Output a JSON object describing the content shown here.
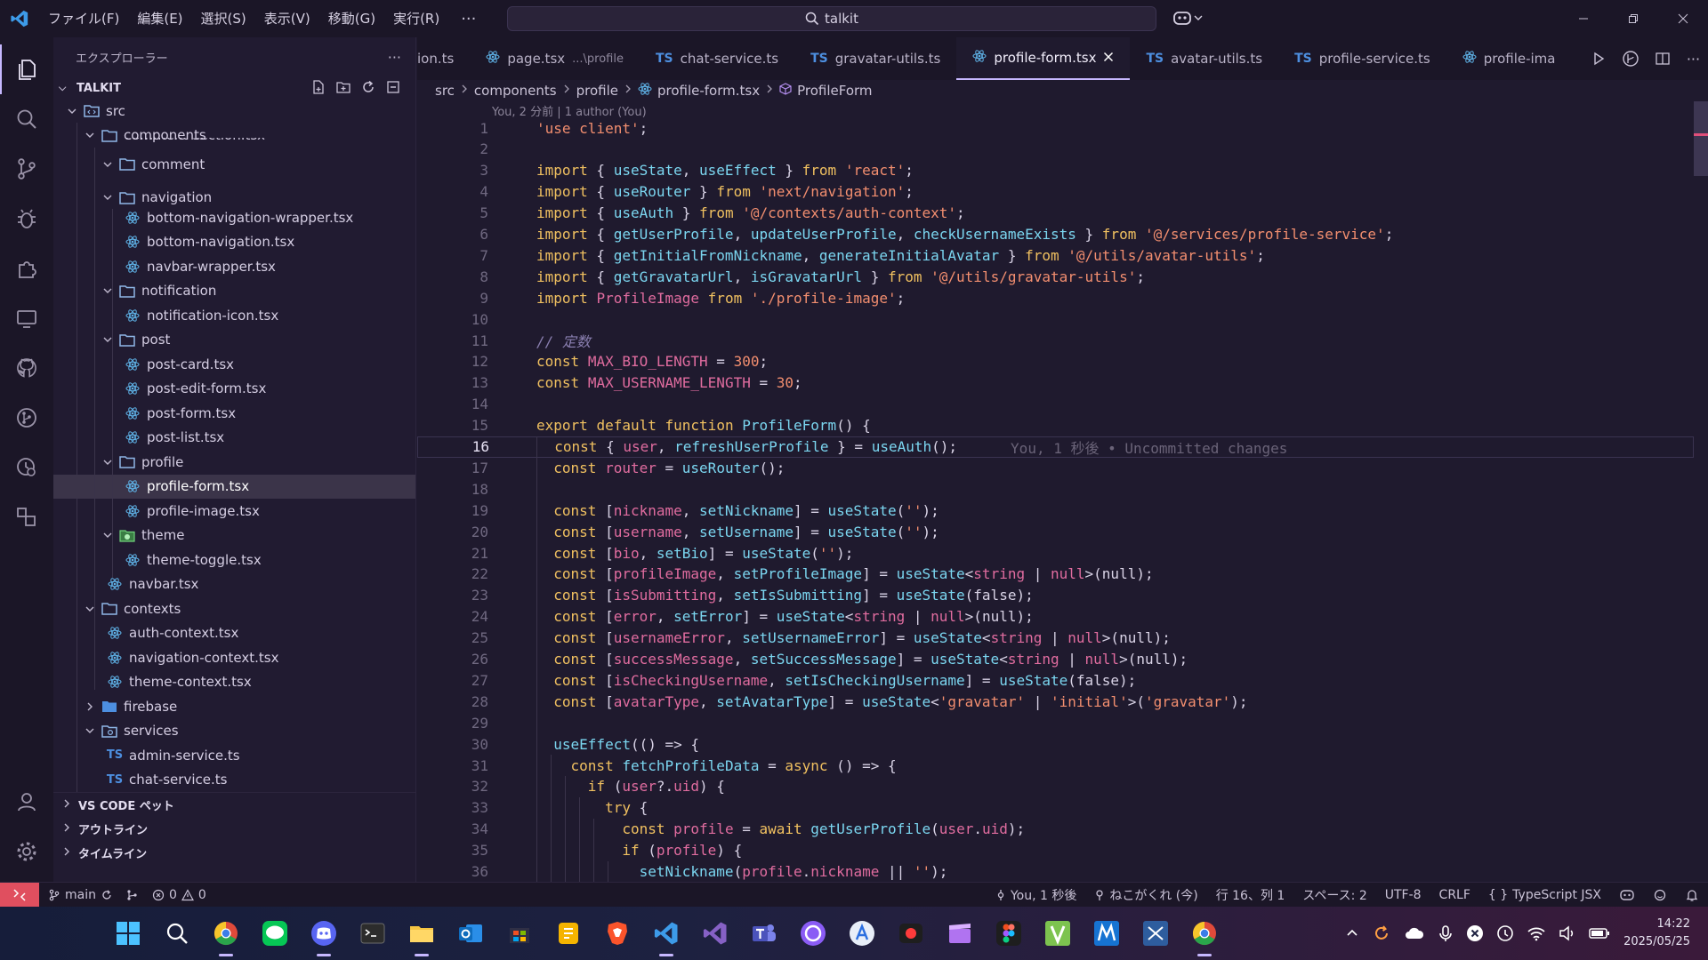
{
  "titlebar": {
    "menus": [
      "ファイル(F)",
      "編集(E)",
      "選択(S)",
      "表示(V)",
      "移動(G)",
      "実行(R)"
    ],
    "more": "···",
    "search": "talkit"
  },
  "sidebar": {
    "title": "エクスプローラー",
    "more": "···",
    "project": "TALKIT",
    "tree": [
      {
        "label": "src",
        "depth": 0,
        "kind": "src-folder",
        "open": true
      },
      {
        "label": "components",
        "depth": 1,
        "kind": "folder",
        "open": true
      },
      {
        "label": "comment",
        "depth": 2,
        "kind": "folder",
        "open": true
      },
      {
        "label": "navigation",
        "depth": 2,
        "kind": "folder",
        "open": true
      },
      {
        "label": "bottom-navigation-wrapper.tsx",
        "depth": 3,
        "kind": "react"
      },
      {
        "label": "bottom-navigation.tsx",
        "depth": 3,
        "kind": "react"
      },
      {
        "label": "navbar-wrapper.tsx",
        "depth": 3,
        "kind": "react"
      },
      {
        "label": "notification",
        "depth": 2,
        "kind": "folder",
        "open": true
      },
      {
        "label": "notification-icon.tsx",
        "depth": 3,
        "kind": "react"
      },
      {
        "label": "post",
        "depth": 2,
        "kind": "folder",
        "open": true
      },
      {
        "label": "post-card.tsx",
        "depth": 3,
        "kind": "react"
      },
      {
        "label": "post-edit-form.tsx",
        "depth": 3,
        "kind": "react"
      },
      {
        "label": "post-form.tsx",
        "depth": 3,
        "kind": "react"
      },
      {
        "label": "post-list.tsx",
        "depth": 3,
        "kind": "react"
      },
      {
        "label": "profile",
        "depth": 2,
        "kind": "folder",
        "open": true
      },
      {
        "label": "profile-form.tsx",
        "depth": 3,
        "kind": "react",
        "selected": true
      },
      {
        "label": "profile-image.tsx",
        "depth": 3,
        "kind": "react"
      },
      {
        "label": "theme",
        "depth": 2,
        "kind": "theme-folder",
        "open": true
      },
      {
        "label": "theme-toggle.tsx",
        "depth": 3,
        "kind": "react"
      },
      {
        "label": "navbar.tsx",
        "depth": 2,
        "kind": "react"
      },
      {
        "label": "contexts",
        "depth": 1,
        "kind": "folder",
        "open": true
      },
      {
        "label": "auth-context.tsx",
        "depth": 2,
        "kind": "react"
      },
      {
        "label": "navigation-context.tsx",
        "depth": 2,
        "kind": "react"
      },
      {
        "label": "theme-context.tsx",
        "depth": 2,
        "kind": "react"
      },
      {
        "label": "firebase",
        "depth": 1,
        "kind": "firebase-folder",
        "open": false
      },
      {
        "label": "services",
        "depth": 1,
        "kind": "services-folder",
        "open": true
      },
      {
        "label": "admin-service.ts",
        "depth": 2,
        "kind": "ts"
      },
      {
        "label": "chat-service.ts",
        "depth": 2,
        "kind": "ts"
      }
    ],
    "sticky_peek": "comment-section.tsx",
    "sections": [
      "VS CODE ペット",
      "アウトライン",
      "タイムライン"
    ]
  },
  "tabs": [
    {
      "label": "ion.ts",
      "kind": "plain"
    },
    {
      "label": "page.tsx",
      "hint": "...\\profile",
      "kind": "react"
    },
    {
      "label": "chat-service.ts",
      "kind": "ts"
    },
    {
      "label": "gravatar-utils.ts",
      "kind": "ts"
    },
    {
      "label": "profile-form.tsx",
      "kind": "react",
      "active": true
    },
    {
      "label": "avatar-utils.ts",
      "kind": "ts"
    },
    {
      "label": "profile-service.ts",
      "kind": "ts"
    },
    {
      "label": "profile-ima",
      "kind": "react"
    }
  ],
  "breadcrumb": [
    "src",
    "components",
    "profile",
    "profile-form.tsx",
    "ProfileForm"
  ],
  "blame": "You, 2 分前 | 1 author (You)",
  "current_line": 16,
  "ghost_text": "You, 1 秒後 • Uncommitted changes",
  "code": [
    [
      [
        "str",
        "'use client'"
      ],
      [
        "p",
        ";"
      ]
    ],
    [],
    [
      [
        "kw",
        "import"
      ],
      [
        "p",
        " { "
      ],
      [
        "fn",
        "useState"
      ],
      [
        "p",
        ", "
      ],
      [
        "fn",
        "useEffect"
      ],
      [
        "p",
        " } "
      ],
      [
        "kw",
        "from"
      ],
      [
        "p",
        " "
      ],
      [
        "str",
        "'react'"
      ],
      [
        "p",
        ";"
      ]
    ],
    [
      [
        "kw",
        "import"
      ],
      [
        "p",
        " { "
      ],
      [
        "fn",
        "useRouter"
      ],
      [
        "p",
        " } "
      ],
      [
        "kw",
        "from"
      ],
      [
        "p",
        " "
      ],
      [
        "str",
        "'next/navigation'"
      ],
      [
        "p",
        ";"
      ]
    ],
    [
      [
        "kw",
        "import"
      ],
      [
        "p",
        " { "
      ],
      [
        "fn",
        "useAuth"
      ],
      [
        "p",
        " } "
      ],
      [
        "kw",
        "from"
      ],
      [
        "p",
        " "
      ],
      [
        "str",
        "'@/contexts/auth-context'"
      ],
      [
        "p",
        ";"
      ]
    ],
    [
      [
        "kw",
        "import"
      ],
      [
        "p",
        " { "
      ],
      [
        "fn",
        "getUserProfile"
      ],
      [
        "p",
        ", "
      ],
      [
        "fn",
        "updateUserProfile"
      ],
      [
        "p",
        ", "
      ],
      [
        "fn",
        "checkUsernameExists"
      ],
      [
        "p",
        " } "
      ],
      [
        "kw",
        "from"
      ],
      [
        "p",
        " "
      ],
      [
        "str",
        "'@/services/profile-service'"
      ],
      [
        "p",
        ";"
      ]
    ],
    [
      [
        "kw",
        "import"
      ],
      [
        "p",
        " { "
      ],
      [
        "fn",
        "getInitialFromNickname"
      ],
      [
        "p",
        ", "
      ],
      [
        "fn",
        "generateInitialAvatar"
      ],
      [
        "p",
        " } "
      ],
      [
        "kw",
        "from"
      ],
      [
        "p",
        " "
      ],
      [
        "str",
        "'@/utils/avatar-utils'"
      ],
      [
        "p",
        ";"
      ]
    ],
    [
      [
        "kw",
        "import"
      ],
      [
        "p",
        " { "
      ],
      [
        "fn",
        "getGravatarUrl"
      ],
      [
        "p",
        ", "
      ],
      [
        "fn",
        "isGravatarUrl"
      ],
      [
        "p",
        " } "
      ],
      [
        "kw",
        "from"
      ],
      [
        "p",
        " "
      ],
      [
        "str",
        "'@/utils/gravatar-utils'"
      ],
      [
        "p",
        ";"
      ]
    ],
    [
      [
        "kw",
        "import"
      ],
      [
        "p",
        " "
      ],
      [
        "var",
        "ProfileImage"
      ],
      [
        "p",
        " "
      ],
      [
        "kw",
        "from"
      ],
      [
        "p",
        " "
      ],
      [
        "str",
        "'./profile-image'"
      ],
      [
        "p",
        ";"
      ]
    ],
    [],
    [
      [
        "com",
        "// 定数"
      ]
    ],
    [
      [
        "kw",
        "const"
      ],
      [
        "p",
        " "
      ],
      [
        "var",
        "MAX_BIO_LENGTH"
      ],
      [
        "p",
        " = "
      ],
      [
        "num",
        "300"
      ],
      [
        "p",
        ";"
      ]
    ],
    [
      [
        "kw",
        "const"
      ],
      [
        "p",
        " "
      ],
      [
        "var",
        "MAX_USERNAME_LENGTH"
      ],
      [
        "p",
        " = "
      ],
      [
        "num",
        "30"
      ],
      [
        "p",
        ";"
      ]
    ],
    [],
    [
      [
        "kw",
        "export"
      ],
      [
        "p",
        " "
      ],
      [
        "kw",
        "default"
      ],
      [
        "p",
        " "
      ],
      [
        "kw",
        "function"
      ],
      [
        "p",
        " "
      ],
      [
        "fn",
        "ProfileForm"
      ],
      [
        "p",
        "() {"
      ]
    ],
    [
      [
        "p",
        "  "
      ],
      [
        "kw",
        "const"
      ],
      [
        "p",
        " { "
      ],
      [
        "var",
        "user"
      ],
      [
        "p",
        ", "
      ],
      [
        "fn",
        "refreshUserProfile"
      ],
      [
        "p",
        " } = "
      ],
      [
        "fn",
        "useAuth"
      ],
      [
        "p",
        "();"
      ]
    ],
    [
      [
        "p",
        "  "
      ],
      [
        "kw",
        "const"
      ],
      [
        "p",
        " "
      ],
      [
        "var",
        "router"
      ],
      [
        "p",
        " = "
      ],
      [
        "fn",
        "useRouter"
      ],
      [
        "p",
        "();"
      ]
    ],
    [],
    [
      [
        "p",
        "  "
      ],
      [
        "kw",
        "const"
      ],
      [
        "p",
        " ["
      ],
      [
        "var",
        "nickname"
      ],
      [
        "p",
        ", "
      ],
      [
        "fn",
        "setNickname"
      ],
      [
        "p",
        "] = "
      ],
      [
        "fn",
        "useState"
      ],
      [
        "p",
        "("
      ],
      [
        "str",
        "''"
      ],
      [
        "p",
        ");"
      ]
    ],
    [
      [
        "p",
        "  "
      ],
      [
        "kw",
        "const"
      ],
      [
        "p",
        " ["
      ],
      [
        "var",
        "username"
      ],
      [
        "p",
        ", "
      ],
      [
        "fn",
        "setUsername"
      ],
      [
        "p",
        "] = "
      ],
      [
        "fn",
        "useState"
      ],
      [
        "p",
        "("
      ],
      [
        "str",
        "''"
      ],
      [
        "p",
        ");"
      ]
    ],
    [
      [
        "p",
        "  "
      ],
      [
        "kw",
        "const"
      ],
      [
        "p",
        " ["
      ],
      [
        "var",
        "bio"
      ],
      [
        "p",
        ", "
      ],
      [
        "fn",
        "setBio"
      ],
      [
        "p",
        "] = "
      ],
      [
        "fn",
        "useState"
      ],
      [
        "p",
        "("
      ],
      [
        "str",
        "''"
      ],
      [
        "p",
        ");"
      ]
    ],
    [
      [
        "p",
        "  "
      ],
      [
        "kw",
        "const"
      ],
      [
        "p",
        " ["
      ],
      [
        "var",
        "profileImage"
      ],
      [
        "p",
        ", "
      ],
      [
        "fn",
        "setProfileImage"
      ],
      [
        "p",
        "] = "
      ],
      [
        "fn",
        "useState"
      ],
      [
        "p",
        "<"
      ],
      [
        "type",
        "string"
      ],
      [
        "p",
        " | "
      ],
      [
        "type",
        "null"
      ],
      [
        "p",
        ">(null);"
      ]
    ],
    [
      [
        "p",
        "  "
      ],
      [
        "kw",
        "const"
      ],
      [
        "p",
        " ["
      ],
      [
        "var",
        "isSubmitting"
      ],
      [
        "p",
        ", "
      ],
      [
        "fn",
        "setIsSubmitting"
      ],
      [
        "p",
        "] = "
      ],
      [
        "fn",
        "useState"
      ],
      [
        "p",
        "(false);"
      ]
    ],
    [
      [
        "p",
        "  "
      ],
      [
        "kw",
        "const"
      ],
      [
        "p",
        " ["
      ],
      [
        "var",
        "error"
      ],
      [
        "p",
        ", "
      ],
      [
        "fn",
        "setError"
      ],
      [
        "p",
        "] = "
      ],
      [
        "fn",
        "useState"
      ],
      [
        "p",
        "<"
      ],
      [
        "type",
        "string"
      ],
      [
        "p",
        " | "
      ],
      [
        "type",
        "null"
      ],
      [
        "p",
        ">(null);"
      ]
    ],
    [
      [
        "p",
        "  "
      ],
      [
        "kw",
        "const"
      ],
      [
        "p",
        " ["
      ],
      [
        "var",
        "usernameError"
      ],
      [
        "p",
        ", "
      ],
      [
        "fn",
        "setUsernameError"
      ],
      [
        "p",
        "] = "
      ],
      [
        "fn",
        "useState"
      ],
      [
        "p",
        "<"
      ],
      [
        "type",
        "string"
      ],
      [
        "p",
        " | "
      ],
      [
        "type",
        "null"
      ],
      [
        "p",
        ">(null);"
      ]
    ],
    [
      [
        "p",
        "  "
      ],
      [
        "kw",
        "const"
      ],
      [
        "p",
        " ["
      ],
      [
        "var",
        "successMessage"
      ],
      [
        "p",
        ", "
      ],
      [
        "fn",
        "setSuccessMessage"
      ],
      [
        "p",
        "] = "
      ],
      [
        "fn",
        "useState"
      ],
      [
        "p",
        "<"
      ],
      [
        "type",
        "string"
      ],
      [
        "p",
        " | "
      ],
      [
        "type",
        "null"
      ],
      [
        "p",
        ">(null);"
      ]
    ],
    [
      [
        "p",
        "  "
      ],
      [
        "kw",
        "const"
      ],
      [
        "p",
        " ["
      ],
      [
        "var",
        "isCheckingUsername"
      ],
      [
        "p",
        ", "
      ],
      [
        "fn",
        "setIsCheckingUsername"
      ],
      [
        "p",
        "] = "
      ],
      [
        "fn",
        "useState"
      ],
      [
        "p",
        "(false);"
      ]
    ],
    [
      [
        "p",
        "  "
      ],
      [
        "kw",
        "const"
      ],
      [
        "p",
        " ["
      ],
      [
        "var",
        "avatarType"
      ],
      [
        "p",
        ", "
      ],
      [
        "fn",
        "setAvatarType"
      ],
      [
        "p",
        "] = "
      ],
      [
        "fn",
        "useState"
      ],
      [
        "p",
        "<"
      ],
      [
        "str",
        "'gravatar'"
      ],
      [
        "p",
        " | "
      ],
      [
        "str",
        "'initial'"
      ],
      [
        "p",
        ">("
      ],
      [
        "str",
        "'gravatar'"
      ],
      [
        "p",
        ");"
      ]
    ],
    [],
    [
      [
        "p",
        "  "
      ],
      [
        "fn",
        "useEffect"
      ],
      [
        "p",
        "(() => {"
      ]
    ],
    [
      [
        "p",
        "    "
      ],
      [
        "kw",
        "const"
      ],
      [
        "p",
        " "
      ],
      [
        "fn",
        "fetchProfileData"
      ],
      [
        "p",
        " = "
      ],
      [
        "kw",
        "async"
      ],
      [
        "p",
        " () => {"
      ]
    ],
    [
      [
        "p",
        "      "
      ],
      [
        "kw",
        "if"
      ],
      [
        "p",
        " ("
      ],
      [
        "var",
        "user"
      ],
      [
        "p",
        "?."
      ],
      [
        "var",
        "uid"
      ],
      [
        "p",
        ") {"
      ]
    ],
    [
      [
        "p",
        "        "
      ],
      [
        "kw",
        "try"
      ],
      [
        "p",
        " {"
      ]
    ],
    [
      [
        "p",
        "          "
      ],
      [
        "kw",
        "const"
      ],
      [
        "p",
        " "
      ],
      [
        "var",
        "profile"
      ],
      [
        "p",
        " = "
      ],
      [
        "kw",
        "await"
      ],
      [
        "p",
        " "
      ],
      [
        "fn",
        "getUserProfile"
      ],
      [
        "p",
        "("
      ],
      [
        "var",
        "user"
      ],
      [
        "p",
        "."
      ],
      [
        "var",
        "uid"
      ],
      [
        "p",
        ");"
      ]
    ],
    [
      [
        "p",
        "          "
      ],
      [
        "kw",
        "if"
      ],
      [
        "p",
        " ("
      ],
      [
        "var",
        "profile"
      ],
      [
        "p",
        ") {"
      ]
    ],
    [
      [
        "p",
        "            "
      ],
      [
        "fn",
        "setNickname"
      ],
      [
        "p",
        "("
      ],
      [
        "var",
        "profile"
      ],
      [
        "p",
        "."
      ],
      [
        "var",
        "nickname"
      ],
      [
        "p",
        " || "
      ],
      [
        "str",
        "''"
      ],
      [
        "p",
        ");"
      ]
    ]
  ],
  "statusbar": {
    "branch": "main",
    "errors": "0",
    "warnings": "0",
    "blame": "You, 1 秒後",
    "user": "ねこがくれ (今)",
    "position": "行 16、列 1",
    "spaces": "スペース: 2",
    "encoding": "UTF-8",
    "eol": "CRLF",
    "language": "TypeScript JSX"
  },
  "clock": {
    "time": "14:22",
    "date": "2025/05/25"
  },
  "colors": {
    "accent": "#c7b8ff",
    "remote": "#e04f5f",
    "react": "#5fb3e8",
    "ts": "#4d8fe0"
  }
}
